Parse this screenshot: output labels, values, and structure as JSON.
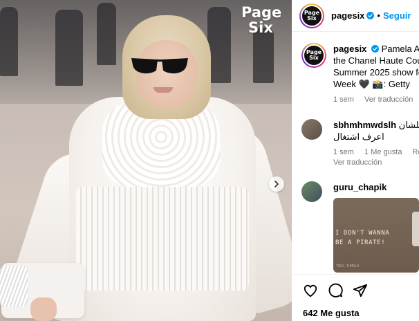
{
  "media": {
    "brand_logo_line1": "Page",
    "brand_logo_line2": "Six"
  },
  "header": {
    "avatar_text": "Page Six",
    "username": "pagesix",
    "separator": "•",
    "follow_label": "Seguir"
  },
  "caption": {
    "avatar_text": "Page Six",
    "username": "pagesix",
    "line1": "Pamela And",
    "line2": "the Chanel Haute Cout",
    "line3": "Summer 2025 show fo",
    "line4": "Week 🖤 📸: Getty",
    "time": "1 sem",
    "translate": "Ver traducción"
  },
  "comments": [
    {
      "username": "sbhmhmwdslh",
      "text_inline": "علشان",
      "text_line2": "اعرف اشتغال",
      "time": "1 sem",
      "likes": "1 Me gusta",
      "reply": "Resp",
      "translate": "Ver traducción"
    },
    {
      "username": "guru_chapik",
      "gif_line1": "I DON'T WANNA",
      "gif_line2": "BE A PIRATE!",
      "gif_footer": "TEDS.TUMBLR"
    }
  ],
  "actions": {
    "likes_count": "642 Me gusta"
  },
  "colors": {
    "accent_blue": "#0095f6",
    "muted": "#737373",
    "brand_pink": "#e0007a"
  }
}
